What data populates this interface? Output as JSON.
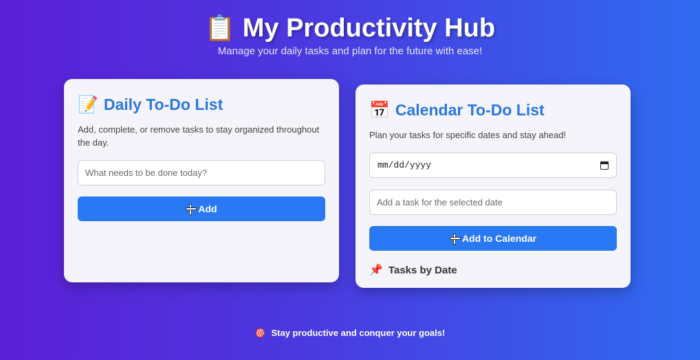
{
  "header": {
    "icon": "clipboard-icon",
    "icon_glyph": "📋",
    "title": "My Productivity Hub",
    "subtitle": "Manage your daily tasks and plan for the future with ease!"
  },
  "daily": {
    "icon": "memo-icon",
    "icon_glyph": "📝",
    "title": "Daily To-Do List",
    "description": "Add, complete, or remove tasks to stay organized throughout the day.",
    "input_placeholder": "What needs to be done today?",
    "input_value": "",
    "add_label": "Add"
  },
  "calendar": {
    "icon": "calendar-icon",
    "icon_glyph": "📅",
    "title": "Calendar To-Do List",
    "description": "Plan your tasks for specific dates and stay ahead!",
    "date_placeholder": "mm/dd/yyyy",
    "task_placeholder": "Add a task for the selected date",
    "task_value": "",
    "add_label": "Add to Calendar",
    "tasks_heading_icon": "pushpin-icon",
    "tasks_heading_glyph": "📌",
    "tasks_heading": "Tasks by Date"
  },
  "footer": {
    "icon": "target-icon",
    "icon_glyph": "🎯",
    "text": "Stay productive and conquer your goals!"
  },
  "colors": {
    "accent": "#2979f5",
    "title_blue": "#2a78e0",
    "bg_start": "#5b1fd6",
    "bg_end": "#2f6bf0"
  }
}
